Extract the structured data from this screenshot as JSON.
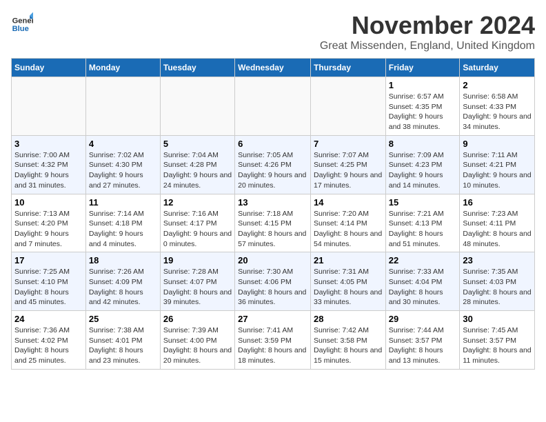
{
  "logo": {
    "general": "General",
    "blue": "Blue"
  },
  "title": "November 2024",
  "location": "Great Missenden, England, United Kingdom",
  "days_of_week": [
    "Sunday",
    "Monday",
    "Tuesday",
    "Wednesday",
    "Thursday",
    "Friday",
    "Saturday"
  ],
  "weeks": [
    [
      {
        "day": "",
        "sunrise": "",
        "sunset": "",
        "daylight": "",
        "empty": true
      },
      {
        "day": "",
        "sunrise": "",
        "sunset": "",
        "daylight": "",
        "empty": true
      },
      {
        "day": "",
        "sunrise": "",
        "sunset": "",
        "daylight": "",
        "empty": true
      },
      {
        "day": "",
        "sunrise": "",
        "sunset": "",
        "daylight": "",
        "empty": true
      },
      {
        "day": "",
        "sunrise": "",
        "sunset": "",
        "daylight": "",
        "empty": true
      },
      {
        "day": "1",
        "sunrise": "Sunrise: 6:57 AM",
        "sunset": "Sunset: 4:35 PM",
        "daylight": "Daylight: 9 hours and 38 minutes.",
        "empty": false
      },
      {
        "day": "2",
        "sunrise": "Sunrise: 6:58 AM",
        "sunset": "Sunset: 4:33 PM",
        "daylight": "Daylight: 9 hours and 34 minutes.",
        "empty": false
      }
    ],
    [
      {
        "day": "3",
        "sunrise": "Sunrise: 7:00 AM",
        "sunset": "Sunset: 4:32 PM",
        "daylight": "Daylight: 9 hours and 31 minutes.",
        "empty": false
      },
      {
        "day": "4",
        "sunrise": "Sunrise: 7:02 AM",
        "sunset": "Sunset: 4:30 PM",
        "daylight": "Daylight: 9 hours and 27 minutes.",
        "empty": false
      },
      {
        "day": "5",
        "sunrise": "Sunrise: 7:04 AM",
        "sunset": "Sunset: 4:28 PM",
        "daylight": "Daylight: 9 hours and 24 minutes.",
        "empty": false
      },
      {
        "day": "6",
        "sunrise": "Sunrise: 7:05 AM",
        "sunset": "Sunset: 4:26 PM",
        "daylight": "Daylight: 9 hours and 20 minutes.",
        "empty": false
      },
      {
        "day": "7",
        "sunrise": "Sunrise: 7:07 AM",
        "sunset": "Sunset: 4:25 PM",
        "daylight": "Daylight: 9 hours and 17 minutes.",
        "empty": false
      },
      {
        "day": "8",
        "sunrise": "Sunrise: 7:09 AM",
        "sunset": "Sunset: 4:23 PM",
        "daylight": "Daylight: 9 hours and 14 minutes.",
        "empty": false
      },
      {
        "day": "9",
        "sunrise": "Sunrise: 7:11 AM",
        "sunset": "Sunset: 4:21 PM",
        "daylight": "Daylight: 9 hours and 10 minutes.",
        "empty": false
      }
    ],
    [
      {
        "day": "10",
        "sunrise": "Sunrise: 7:13 AM",
        "sunset": "Sunset: 4:20 PM",
        "daylight": "Daylight: 9 hours and 7 minutes.",
        "empty": false
      },
      {
        "day": "11",
        "sunrise": "Sunrise: 7:14 AM",
        "sunset": "Sunset: 4:18 PM",
        "daylight": "Daylight: 9 hours and 4 minutes.",
        "empty": false
      },
      {
        "day": "12",
        "sunrise": "Sunrise: 7:16 AM",
        "sunset": "Sunset: 4:17 PM",
        "daylight": "Daylight: 9 hours and 0 minutes.",
        "empty": false
      },
      {
        "day": "13",
        "sunrise": "Sunrise: 7:18 AM",
        "sunset": "Sunset: 4:15 PM",
        "daylight": "Daylight: 8 hours and 57 minutes.",
        "empty": false
      },
      {
        "day": "14",
        "sunrise": "Sunrise: 7:20 AM",
        "sunset": "Sunset: 4:14 PM",
        "daylight": "Daylight: 8 hours and 54 minutes.",
        "empty": false
      },
      {
        "day": "15",
        "sunrise": "Sunrise: 7:21 AM",
        "sunset": "Sunset: 4:13 PM",
        "daylight": "Daylight: 8 hours and 51 minutes.",
        "empty": false
      },
      {
        "day": "16",
        "sunrise": "Sunrise: 7:23 AM",
        "sunset": "Sunset: 4:11 PM",
        "daylight": "Daylight: 8 hours and 48 minutes.",
        "empty": false
      }
    ],
    [
      {
        "day": "17",
        "sunrise": "Sunrise: 7:25 AM",
        "sunset": "Sunset: 4:10 PM",
        "daylight": "Daylight: 8 hours and 45 minutes.",
        "empty": false
      },
      {
        "day": "18",
        "sunrise": "Sunrise: 7:26 AM",
        "sunset": "Sunset: 4:09 PM",
        "daylight": "Daylight: 8 hours and 42 minutes.",
        "empty": false
      },
      {
        "day": "19",
        "sunrise": "Sunrise: 7:28 AM",
        "sunset": "Sunset: 4:07 PM",
        "daylight": "Daylight: 8 hours and 39 minutes.",
        "empty": false
      },
      {
        "day": "20",
        "sunrise": "Sunrise: 7:30 AM",
        "sunset": "Sunset: 4:06 PM",
        "daylight": "Daylight: 8 hours and 36 minutes.",
        "empty": false
      },
      {
        "day": "21",
        "sunrise": "Sunrise: 7:31 AM",
        "sunset": "Sunset: 4:05 PM",
        "daylight": "Daylight: 8 hours and 33 minutes.",
        "empty": false
      },
      {
        "day": "22",
        "sunrise": "Sunrise: 7:33 AM",
        "sunset": "Sunset: 4:04 PM",
        "daylight": "Daylight: 8 hours and 30 minutes.",
        "empty": false
      },
      {
        "day": "23",
        "sunrise": "Sunrise: 7:35 AM",
        "sunset": "Sunset: 4:03 PM",
        "daylight": "Daylight: 8 hours and 28 minutes.",
        "empty": false
      }
    ],
    [
      {
        "day": "24",
        "sunrise": "Sunrise: 7:36 AM",
        "sunset": "Sunset: 4:02 PM",
        "daylight": "Daylight: 8 hours and 25 minutes.",
        "empty": false
      },
      {
        "day": "25",
        "sunrise": "Sunrise: 7:38 AM",
        "sunset": "Sunset: 4:01 PM",
        "daylight": "Daylight: 8 hours and 23 minutes.",
        "empty": false
      },
      {
        "day": "26",
        "sunrise": "Sunrise: 7:39 AM",
        "sunset": "Sunset: 4:00 PM",
        "daylight": "Daylight: 8 hours and 20 minutes.",
        "empty": false
      },
      {
        "day": "27",
        "sunrise": "Sunrise: 7:41 AM",
        "sunset": "Sunset: 3:59 PM",
        "daylight": "Daylight: 8 hours and 18 minutes.",
        "empty": false
      },
      {
        "day": "28",
        "sunrise": "Sunrise: 7:42 AM",
        "sunset": "Sunset: 3:58 PM",
        "daylight": "Daylight: 8 hours and 15 minutes.",
        "empty": false
      },
      {
        "day": "29",
        "sunrise": "Sunrise: 7:44 AM",
        "sunset": "Sunset: 3:57 PM",
        "daylight": "Daylight: 8 hours and 13 minutes.",
        "empty": false
      },
      {
        "day": "30",
        "sunrise": "Sunrise: 7:45 AM",
        "sunset": "Sunset: 3:57 PM",
        "daylight": "Daylight: 8 hours and 11 minutes.",
        "empty": false
      }
    ]
  ]
}
